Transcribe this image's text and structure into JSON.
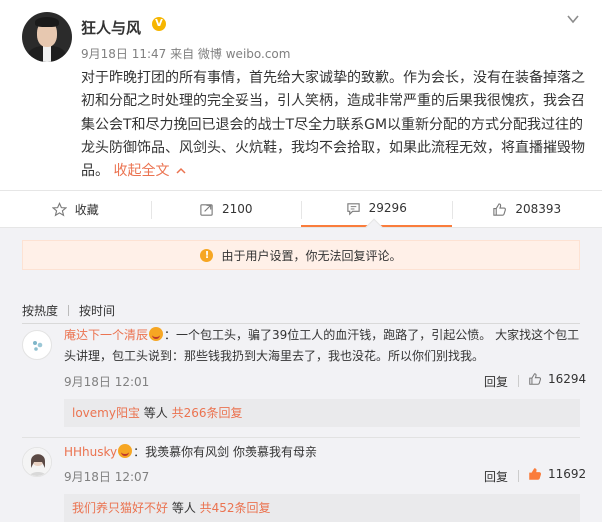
{
  "post": {
    "username": "狂人与风",
    "verified_badge": "V",
    "meta": "9月18日 11:47 来自 微博 weibo.com",
    "text": "对于昨晚打团的所有事情，首先给大家诚挚的致歉。作为会长，没有在装备掉落之初和分配之时处理的完全妥当，引人笑柄，造成非常严重的后果我很愧疚，我会召集公会T和尽力挽回已退会的战士T尽全力联系GM以重新分配的方式分配我过往的龙头防御饰品、风剑头、火炕鞋，我均不会拾取，如果此流程无效，将直播摧毁物品。",
    "collapse_label": "收起全文",
    "collapse_icon": "chevron-up-icon",
    "menu_icon": "chevron-down-icon"
  },
  "actions": [
    {
      "label": "收藏",
      "icon": "star-icon"
    },
    {
      "label": "2100",
      "icon": "repost-icon"
    },
    {
      "label": "29296",
      "icon": "comment-icon"
    },
    {
      "label": "208393",
      "icon": "thumbs-up-icon"
    }
  ],
  "notice": {
    "text": "由于用户设置，你无法回复评论。",
    "icon": "warning-icon"
  },
  "sort": {
    "hot": "按热度",
    "time": "按时间"
  },
  "comments": [
    {
      "name": "庵达下一个清辰",
      "badge": "emoji",
      "text": "：一个包工头，骗了39位工人的血汗钱，跑路了，引起公愤。 大家找这个包工头讲理，包工头说到：那些钱我扔到大海里去了，我也没花。所以你们别找我。",
      "time": "9月18日 12:01",
      "reply": "回复",
      "likes": "16294",
      "sub_name": "lovemy阳宝",
      "sub_mid": " 等人 ",
      "sub_count": "共266条回复"
    },
    {
      "name": "HHhusky",
      "badge": "emoji",
      "text": "：我羡慕你有风剑 你羡慕我有母亲",
      "time": "9月18日 12:07",
      "reply": "回复",
      "likes": "11692",
      "sub_name": "我们养只猫好不好",
      "sub_mid": " 等人 ",
      "sub_count": "共452条回复"
    }
  ],
  "colors": {
    "accent": "#eb7350",
    "like_active": "#fa7d3c",
    "notice_bg": "#fff0e8",
    "warning": "#f6a623",
    "verified": "#f6b500"
  }
}
